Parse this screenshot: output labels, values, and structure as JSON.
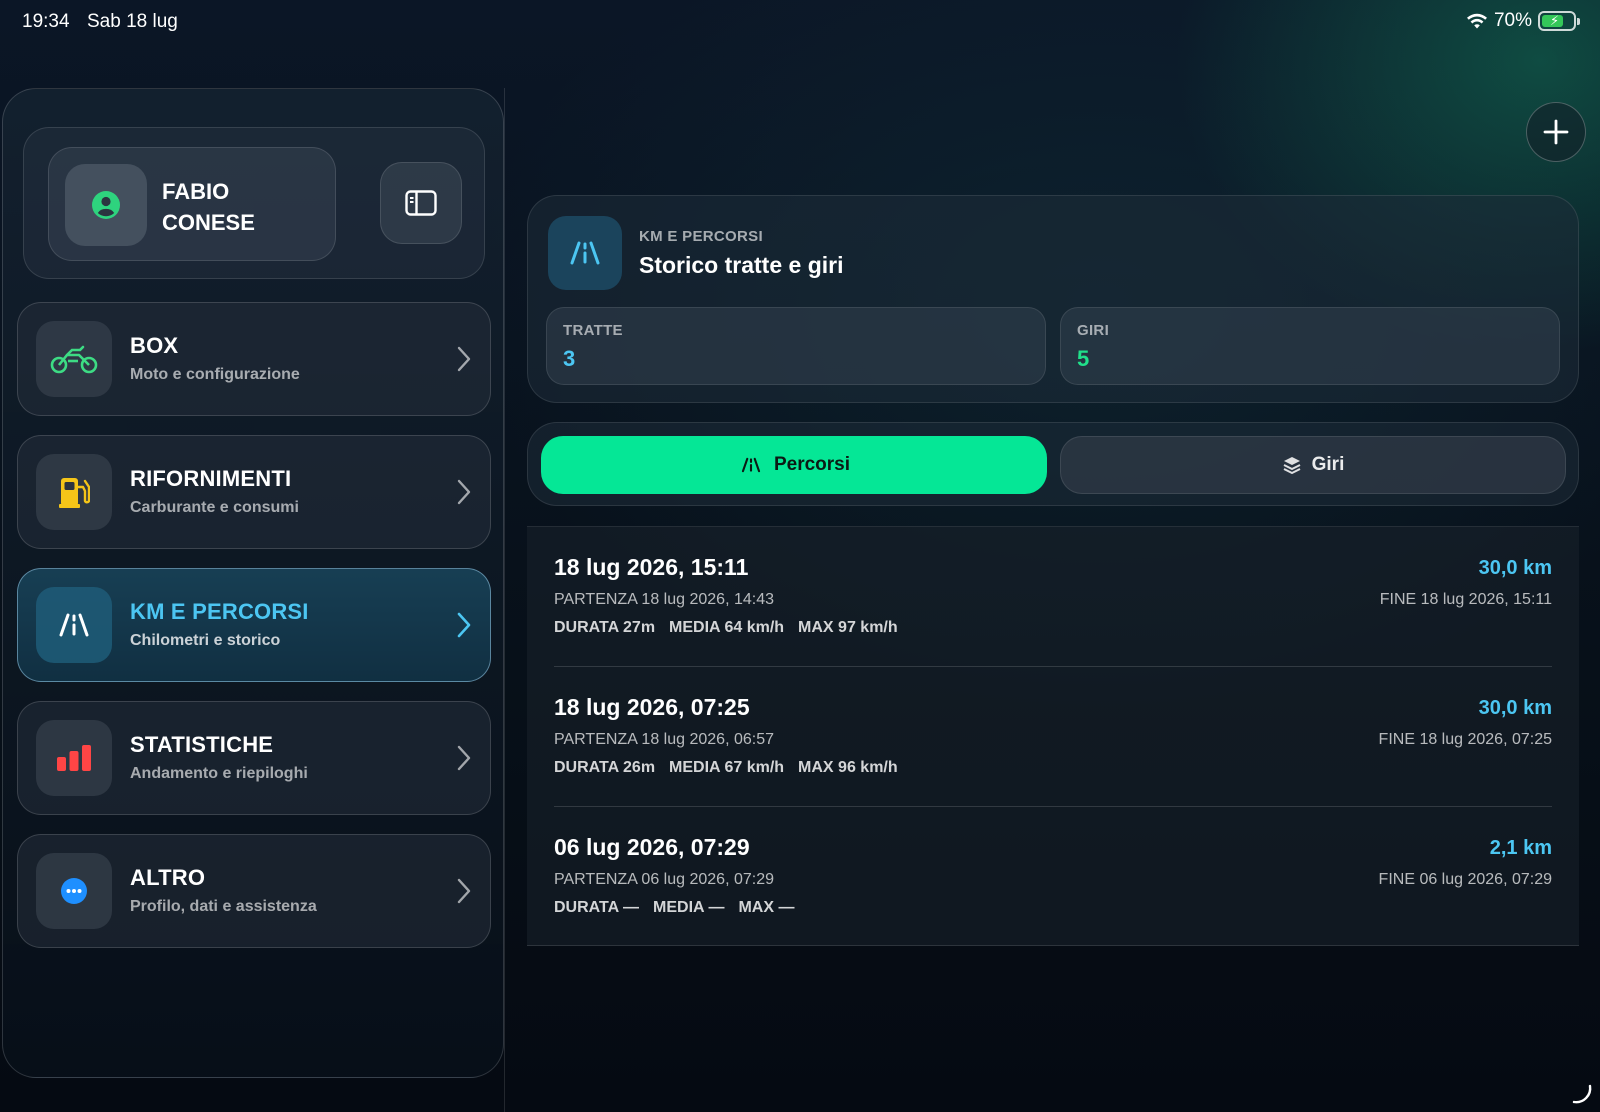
{
  "status_bar": {
    "time": "19:34",
    "date": "Sab 18 lug",
    "battery": "70%",
    "battery_level": 0.7
  },
  "sidebar": {
    "profile": {
      "name": "FABIO CONESE",
      "avatar_icon": "person-circle-icon"
    },
    "toggle_icon": "sidebar-toggle-icon",
    "items": [
      {
        "title": "BOX",
        "subtitle": "Moto e configurazione",
        "icon": "motorcycle-icon",
        "icon_color": "#3ddc84"
      },
      {
        "title": "RIFORNIMENTI",
        "subtitle": "Carburante e consumi",
        "icon": "fuel-pump-icon",
        "icon_color": "#f5c518"
      },
      {
        "title": "KM E PERCORSI",
        "subtitle": "Chilometri e storico",
        "icon": "road-icon",
        "icon_color": "#ffffff",
        "active": true
      },
      {
        "title": "STATISTICHE",
        "subtitle": "Andamento e riepiloghi",
        "icon": "bar-chart-icon",
        "icon_color": "#ff4545"
      },
      {
        "title": "ALTRO",
        "subtitle": "Profilo, dati e assistenza",
        "icon": "more-icon",
        "icon_color": "#1e8fff"
      }
    ]
  },
  "main": {
    "add_icon": "plus-icon",
    "header": {
      "eyebrow": "KM E PERCORSI",
      "title": "Storico tratte e giri",
      "icon": "road-icon"
    },
    "stats": [
      {
        "label": "TRATTE",
        "value": "3",
        "color": "#4cc6f2"
      },
      {
        "label": "GIRI",
        "value": "5",
        "color": "#20e08a"
      }
    ],
    "segments": [
      {
        "label": "Percorsi",
        "icon": "road-icon",
        "selected": true
      },
      {
        "label": "Giri",
        "icon": "layers-icon",
        "selected": false
      }
    ],
    "accent": "#05e796",
    "trips": [
      {
        "title": "18 lug 2026, 15:11",
        "km": "30,0 km",
        "start": "PARTENZA 18 lug 2026, 14:43",
        "end": "FINE 18 lug 2026, 15:11",
        "durata": "DURATA 27m",
        "media": "MEDIA 64 km/h",
        "max": "MAX 97 km/h"
      },
      {
        "title": "18 lug 2026, 07:25",
        "km": "30,0 km",
        "start": "PARTENZA 18 lug 2026, 06:57",
        "end": "FINE 18 lug 2026, 07:25",
        "durata": "DURATA 26m",
        "media": "MEDIA 67 km/h",
        "max": "MAX 96 km/h"
      },
      {
        "title": "06 lug 2026, 07:29",
        "km": "2,1 km",
        "start": "PARTENZA 06 lug 2026, 07:29",
        "end": "FINE 06 lug 2026, 07:29",
        "durata": "DURATA —",
        "media": "MEDIA —",
        "max": "MAX —"
      }
    ]
  }
}
